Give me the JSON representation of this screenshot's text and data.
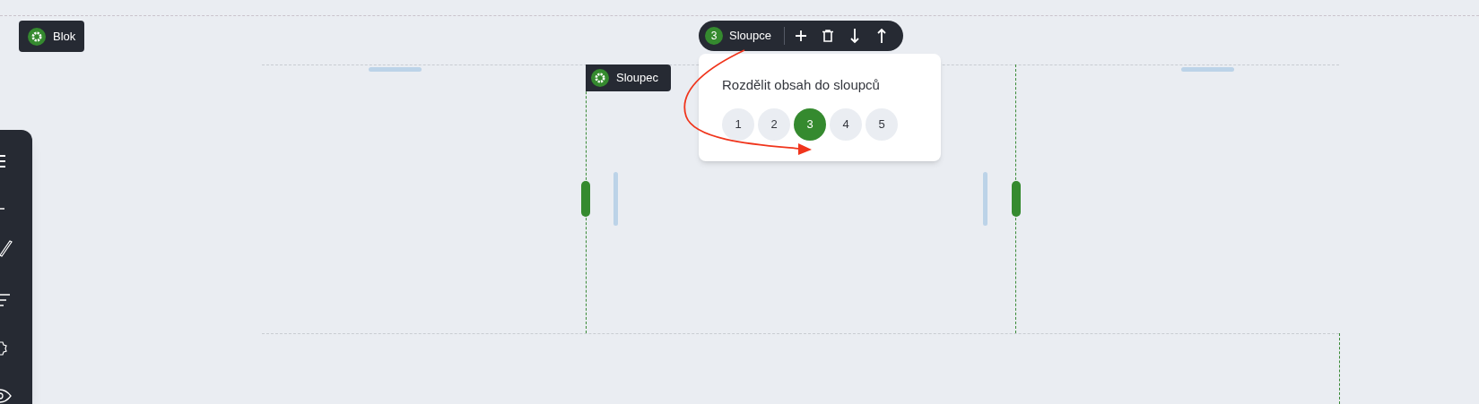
{
  "block_label": "Blok",
  "column_label": "Sloupec",
  "columns_toolbar": {
    "count": "3",
    "label": "Sloupce"
  },
  "popover": {
    "title": "Rozdělit obsah do sloupců",
    "options": [
      {
        "label": "1",
        "selected": false
      },
      {
        "label": "2",
        "selected": false
      },
      {
        "label": "3",
        "selected": true
      },
      {
        "label": "4",
        "selected": false
      },
      {
        "label": "5",
        "selected": false
      }
    ]
  }
}
